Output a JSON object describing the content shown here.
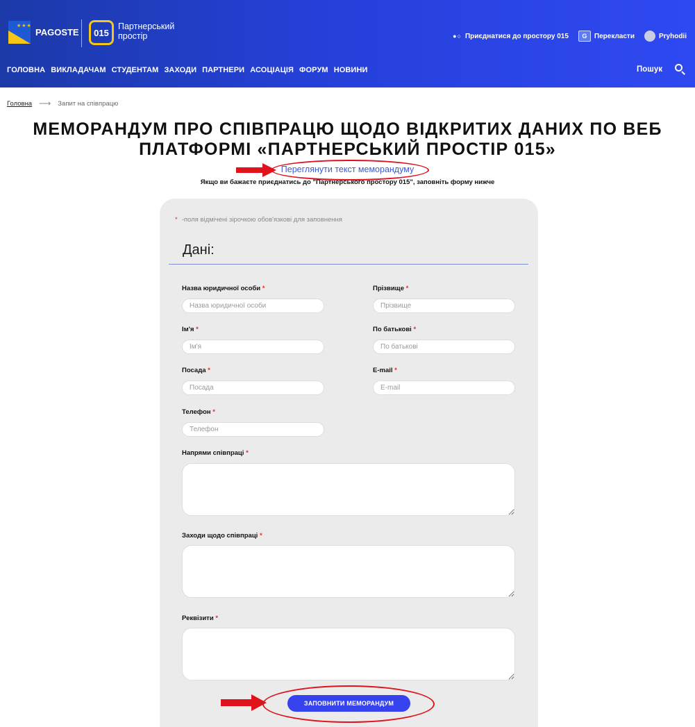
{
  "header": {
    "brand": "PAGOSTE",
    "badge": "015",
    "partner_line1": "Партнерський",
    "partner_line2": "простір",
    "join": "Приєднатися до простору 015",
    "translate": "Перекласти",
    "user": "Pryhodii",
    "nav": [
      "ГОЛОВНА",
      "ВИКЛАДАЧАМ",
      "СТУДЕНТАМ",
      "ЗАХОДИ",
      "ПАРТНЕРИ",
      "АСОЦІАЦІЯ",
      "ФОРУМ",
      "НОВИНИ"
    ],
    "search_label": "Пошук"
  },
  "breadcrumb": {
    "home": "Головна",
    "current": "Запит на співпрацю"
  },
  "page": {
    "title_line1": "МЕМОРАНДУМ ПРО СПІВПРАЦЮ ЩОДО ВІДКРИТИХ ДАНИХ ПО ВЕБ",
    "title_line2": "ПЛАТФОРМІ «ПАРТНЕРСЬКИЙ ПРОСТІР 015»",
    "view_link": "Переглянути текст меморандуму",
    "hint": "Якщо ви бажаєте приєднатись до \"Партнерського простору 015\", заповніть форму нижче"
  },
  "form": {
    "required_note": "-поля відмічені зірочкою обов'язкові для заповнення",
    "section_title": "Дані:",
    "org_label": "Назва юридичної особи",
    "org_placeholder": "Назва юридичної особи",
    "surname_label": "Прізвище",
    "surname_placeholder": "Прізвище",
    "name_label": "Ім'я",
    "name_placeholder": "Ім'я",
    "patronymic_label": "По батькові",
    "patronymic_placeholder": "По батькові",
    "position_label": "Посада",
    "position_placeholder": "Посада",
    "email_label": "E-mail",
    "email_placeholder": "E-mail",
    "phone_label": "Телефон",
    "phone_placeholder": "Телефон",
    "directions_label": "Напрями співпраці",
    "measures_label": "Заходи щодо співпраці",
    "requisites_label": "Реквізити",
    "submit": "ЗАПОВНИТИ МЕМОРАНДУМ",
    "required_mark": "*"
  },
  "colors": {
    "header_start": "#1c3aa8",
    "header_end": "#2f49f2",
    "accent_yellow": "#f5c518",
    "link_blue": "#3a5bd8",
    "button_blue": "#3642ee",
    "annotation_red": "#e0121b",
    "required_red": "#e03030"
  }
}
